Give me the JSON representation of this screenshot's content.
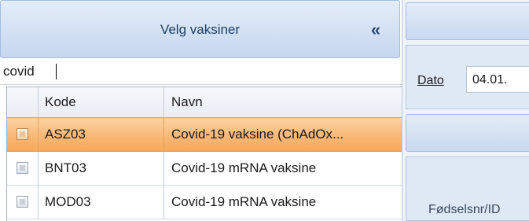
{
  "vaccine_panel": {
    "title": "Velg vaksiner",
    "collapse_icon": "«"
  },
  "search": {
    "value": "covid",
    "placeholder": ""
  },
  "grid": {
    "columns": [
      "Kode",
      "Navn"
    ],
    "rows": [
      {
        "kode": "ASZ03",
        "navn": "Covid-19 vaksine (ChAdOx...",
        "selected": true
      },
      {
        "kode": "BNT03",
        "navn": "Covid-19 mRNA vaksine",
        "selected": false
      },
      {
        "kode": "MOD03",
        "navn": "Covid-19 mRNA vaksine",
        "selected": false
      }
    ]
  },
  "right_panel": {
    "date_label": "Dato",
    "date_value": "04.01.",
    "id_label": "Fødselsnr/ID"
  },
  "colors": {
    "header_blue": "#d5e2f4",
    "selected_row": "#f9b877",
    "accent_text": "#1e3e63"
  }
}
